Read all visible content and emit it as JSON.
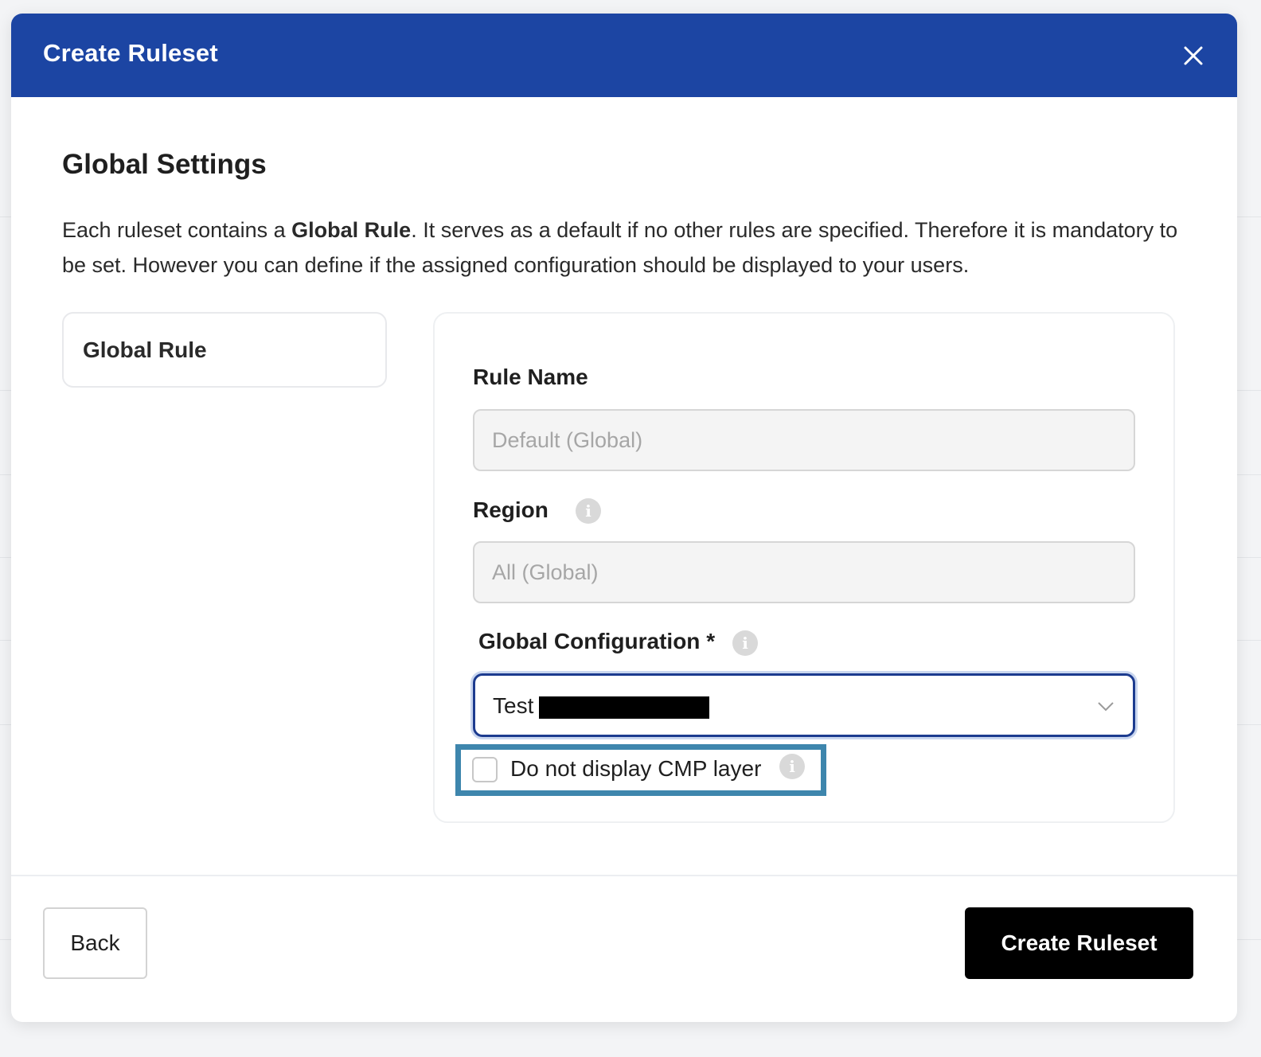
{
  "modal": {
    "title": "Create Ruleset",
    "close_icon": "close-icon"
  },
  "section": {
    "title": "Global Settings",
    "intro_before": "Each ruleset contains a ",
    "intro_bold": "Global Rule",
    "intro_after": ". It serves as a default if no other rules are specified. Therefore it is mandatory to be set. However you can define if the assigned configuration should be displayed to your users."
  },
  "rules_list": {
    "items": [
      {
        "label": "Global Rule"
      }
    ]
  },
  "form": {
    "rule_name": {
      "label": "Rule Name",
      "placeholder": "Default (Global)"
    },
    "region": {
      "label": "Region",
      "placeholder": "All (Global)",
      "info_icon": "info-icon"
    },
    "global_configuration": {
      "label": "Global Configuration",
      "required_mark": "*",
      "value": "Test",
      "info_icon": "info-icon",
      "dropdown_icon": "chevron-down-icon"
    },
    "hide_cmp": {
      "label": "Do not display CMP layer",
      "checked": false,
      "info_icon": "info-icon"
    }
  },
  "footer": {
    "back_label": "Back",
    "create_label": "Create Ruleset"
  },
  "colors": {
    "header": "#1c45a3",
    "focus_border": "#1c3b8f",
    "highlight": "#3e86ad",
    "primary_button": "#000000"
  }
}
